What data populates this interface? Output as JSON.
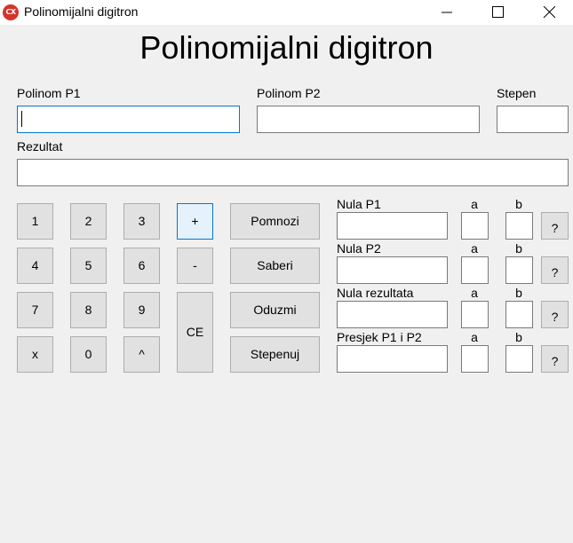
{
  "window": {
    "title": "Polinomijalni digitron",
    "icon_text": "CX"
  },
  "heading": "Polinomijalni digitron",
  "labels": {
    "p1": "Polinom P1",
    "p2": "Polinom P2",
    "stepen": "Stepen",
    "rezultat": "Rezultat"
  },
  "keypad": [
    "1",
    "2",
    "3",
    "4",
    "5",
    "6",
    "7",
    "8",
    "9",
    "x",
    "0",
    "^"
  ],
  "operators": {
    "plus": "+",
    "minus": "-",
    "ce": "CE"
  },
  "actions": [
    "Pomnozi",
    "Saberi",
    "Oduzmi",
    "Stepenuj"
  ],
  "zero_rows": [
    {
      "label": "Nula P1",
      "a": "a",
      "b": "b",
      "q": "?"
    },
    {
      "label": "Nula P2",
      "a": "a",
      "b": "b",
      "q": "?"
    },
    {
      "label": "Nula rezultata",
      "a": "a",
      "b": "b",
      "q": "?"
    },
    {
      "label": "Presjek P1 i P2",
      "a": "a",
      "b": "b",
      "q": "?"
    }
  ]
}
